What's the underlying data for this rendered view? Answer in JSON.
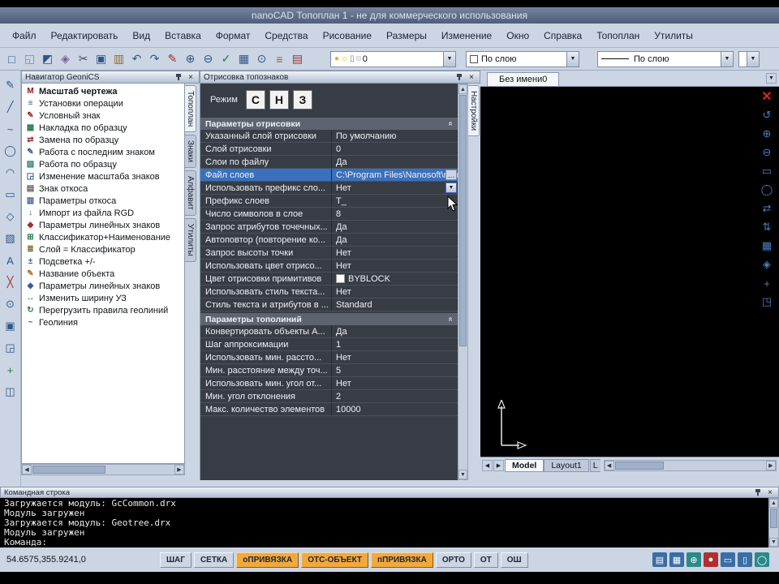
{
  "title_bar": {
    "title": "nanoCAD Топоплан 1 - не для коммерческого использования"
  },
  "menu": {
    "items": [
      "Файл",
      "Редактировать",
      "Вид",
      "Вставка",
      "Формат",
      "Средства",
      "Рисование",
      "Размеры",
      "Изменение",
      "Окно",
      "Справка",
      "Топоплан",
      "Утилиты"
    ]
  },
  "toolbar": {
    "icons": [
      {
        "name": "new-file-icon",
        "glyph": "□",
        "color": "#2f5588"
      },
      {
        "name": "open-file-icon",
        "glyph": "◱",
        "color": "#b08830"
      },
      {
        "name": "save-icon",
        "glyph": "◩",
        "color": "#2f5588"
      },
      {
        "name": "stamp-icon",
        "glyph": "◈",
        "color": "#7a5a9a"
      },
      {
        "name": "cut-icon",
        "glyph": "✂",
        "color": "#444c5a"
      },
      {
        "name": "copy-icon",
        "glyph": "▣",
        "color": "#2f5588"
      },
      {
        "name": "paste-icon",
        "glyph": "▥",
        "color": "#8a6a2a"
      },
      {
        "name": "undo-icon",
        "glyph": "↶",
        "color": "#2f5588"
      },
      {
        "name": "redo-icon",
        "glyph": "↷",
        "color": "#2f5588"
      },
      {
        "name": "format-painter-icon",
        "glyph": "✎",
        "color": "#a03030"
      },
      {
        "name": "zoom-in-icon",
        "glyph": "⊕",
        "color": "#2f5588"
      },
      {
        "name": "zoom-out-icon",
        "glyph": "⊖",
        "color": "#2f5588"
      },
      {
        "name": "check-icon",
        "glyph": "✓",
        "color": "#2a7a2a"
      },
      {
        "name": "table-icon",
        "glyph": "▦",
        "color": "#2f5588"
      },
      {
        "name": "attach-icon",
        "glyph": "⊙",
        "color": "#2f5588"
      },
      {
        "name": "script-icon",
        "glyph": "≡",
        "color": "#8a6a2a"
      },
      {
        "name": "calc-icon",
        "glyph": "▤",
        "color": "#a03030"
      }
    ],
    "layer_combo": {
      "icons": [
        {
          "name": "bulb-icon",
          "glyph": "●",
          "color": "#e0b020"
        },
        {
          "name": "sun-icon",
          "glyph": "☼",
          "color": "#e0b020"
        },
        {
          "name": "lock-icon",
          "glyph": "▯",
          "color": "#707a8a"
        },
        {
          "name": "layer-swatch-icon",
          "glyph": "■",
          "color": "#e8e8e8"
        }
      ],
      "value": "0"
    },
    "color_combo": {
      "value": "По слою"
    },
    "linetype_combo": {
      "value": "По слою"
    }
  },
  "left_toolbar": {
    "icons": [
      {
        "name": "pencil-icon",
        "glyph": "✎",
        "color": "#2f5588"
      },
      {
        "name": "line-icon",
        "glyph": "╱",
        "color": "#2f5588"
      },
      {
        "name": "polyline-icon",
        "glyph": "~",
        "color": "#2f5588"
      },
      {
        "name": "circle-icon",
        "glyph": "◯",
        "color": "#2f5588"
      },
      {
        "name": "arc-icon",
        "glyph": "◠",
        "color": "#2f5588"
      },
      {
        "name": "rectangle-icon",
        "glyph": "▭",
        "color": "#2f5588"
      },
      {
        "name": "polygon-icon",
        "glyph": "◇",
        "color": "#2f5588"
      },
      {
        "name": "hatch-icon",
        "glyph": "▨",
        "color": "#2f5588"
      },
      {
        "name": "text-icon",
        "glyph": "A",
        "color": "#2f5588"
      },
      {
        "name": "erase-icon",
        "glyph": "╳",
        "color": "#a03030"
      },
      {
        "name": "point-icon",
        "glyph": "⊙",
        "color": "#2f5588"
      },
      {
        "name": "block-icon",
        "glyph": "▣",
        "color": "#2f5588"
      },
      {
        "name": "scale-icon",
        "glyph": "◲",
        "color": "#2f5588"
      },
      {
        "name": "plus-icon",
        "glyph": "+",
        "color": "#2a7a4a"
      },
      {
        "name": "dimension-icon",
        "glyph": "◫",
        "color": "#2f5588"
      }
    ]
  },
  "navigator": {
    "title": "Навигатор GeoniCS",
    "items": [
      {
        "label": "Масштаб чертежа",
        "bold": true,
        "icon": "M",
        "icon_color": "#8a1a1a",
        "icon_name": "scale-drawing-icon"
      },
      {
        "label": "Установки операции",
        "icon": "≡",
        "icon_color": "#3a5a9a",
        "icon_name": "operation-settings-icon"
      },
      {
        "label": "Условный знак",
        "icon": "✎",
        "icon_color": "#a03030",
        "icon_name": "symbol-icon"
      },
      {
        "label": "Накладка по образцу",
        "icon": "▦",
        "icon_color": "#2a7a4a",
        "icon_name": "overlay-icon"
      },
      {
        "label": "Замена по образцу",
        "icon": "⇄",
        "icon_color": "#a03030",
        "icon_name": "replace-icon"
      },
      {
        "label": "Работа с последним знаком",
        "icon": "✎",
        "icon_color": "#3a5a9a",
        "icon_name": "last-symbol-icon"
      },
      {
        "label": "Работа по образцу",
        "icon": "▨",
        "icon_color": "#2a7a7a",
        "icon_name": "by-sample-icon"
      },
      {
        "label": "Изменение масштаба знаков",
        "icon": "◲",
        "icon_color": "#3a5a9a",
        "icon_name": "symbol-scale-icon"
      },
      {
        "label": "Знак откоса",
        "icon": "▤",
        "icon_color": "#5a5a5a",
        "icon_name": "slope-symbol-icon"
      },
      {
        "label": "Параметры откоса",
        "icon": "▥",
        "icon_color": "#3a5a9a",
        "icon_name": "slope-params-icon"
      },
      {
        "label": "Импорт из файла RGD",
        "icon": "↓",
        "icon_color": "#3a5a9a",
        "icon_name": "rgd-import-icon"
      },
      {
        "label": "Параметры линейных знаков",
        "icon": "◆",
        "icon_color": "#a03030",
        "icon_name": "linear-symbol-params-icon"
      },
      {
        "label": "Классификатор+Наименование",
        "icon": "⊞",
        "icon_color": "#2a7a4a",
        "icon_name": "classifier-name-icon"
      },
      {
        "label": "Слой = Классификатор",
        "icon": "≣",
        "icon_color": "#7a6a2a",
        "icon_name": "layer-classifier-icon"
      },
      {
        "label": "Подсветка +/-",
        "icon": "±",
        "icon_color": "#3a5a9a",
        "icon_name": "highlight-icon"
      },
      {
        "label": "Название объекта",
        "icon": "✎",
        "icon_color": "#b07020",
        "icon_name": "object-name-icon"
      },
      {
        "label": "Параметры линейных знаков",
        "icon": "◆",
        "icon_color": "#3a5a9a",
        "icon_name": "linear-symbol-params2-icon"
      },
      {
        "label": "Изменить ширину УЗ",
        "icon": "↔",
        "icon_color": "#2a7a4a",
        "icon_name": "width-change-icon"
      },
      {
        "label": "Перегрузить правила геолиний",
        "icon": "↻",
        "icon_color": "#2a7a4a",
        "icon_name": "reload-rules-icon"
      },
      {
        "label": "Геолиния",
        "icon": "~",
        "icon_color": "#3a5a9a",
        "icon_name": "geoline-icon"
      }
    ],
    "tabs": [
      "Топоплан",
      "Знаки",
      "Алфавит",
      "Утилиты"
    ]
  },
  "properties_panel": {
    "title": "Отрисовка топознаков",
    "mode_label": "Режим",
    "mode_buttons": [
      "С",
      "Н",
      "З"
    ],
    "side_tab": "Настройки",
    "sections": [
      {
        "header": "Параметры отрисовки",
        "rows": [
          {
            "label": "Указанный слой отрисовки",
            "value": "По умолчанию"
          },
          {
            "label": "Слой отрисовки",
            "value": "0"
          },
          {
            "label": "Слои по файлу",
            "value": "Да"
          },
          {
            "label": "Файл слоев",
            "value": "C:\\Program Files\\Nanosoft\\nano",
            "selected": true,
            "browse": true
          },
          {
            "label": "Использовать префикс сло...",
            "value": "Нет",
            "dropdown": true
          },
          {
            "label": "Префикс слоев",
            "value": "T_"
          },
          {
            "label": "Число символов в слое",
            "value": "8"
          },
          {
            "label": "Запрос атрибутов точечных...",
            "value": "Да"
          },
          {
            "label": "Автоповтор (повторение ко...",
            "value": "Да"
          },
          {
            "label": "Запрос высоты точки",
            "value": "Нет"
          },
          {
            "label": "Использовать цвет отрисо...",
            "value": "Нет"
          },
          {
            "label": "Цвет отрисовки примитивов",
            "value": "BYBLOCK",
            "swatch": true
          },
          {
            "label": "Использовать стиль текста...",
            "value": "Нет"
          },
          {
            "label": "Стиль текста и атрибутов в ...",
            "value": "Standard"
          }
        ]
      },
      {
        "header": "Параметры тополиний",
        "rows": [
          {
            "label": "Конвертировать объекты А...",
            "value": "Да"
          },
          {
            "label": "Шаг аппроксимации",
            "value": "1"
          },
          {
            "label": "Использовать мин. рассто...",
            "value": "Нет"
          },
          {
            "label": "Мин. расстояние между точ...",
            "value": "5"
          },
          {
            "label": "Использовать мин. угол от...",
            "value": "Нет"
          },
          {
            "label": "Мин. угол отклонения",
            "value": "2"
          },
          {
            "label": "Макс. количество элементов",
            "value": "10000"
          }
        ]
      }
    ]
  },
  "drawing": {
    "doc_tab": "Без имени0",
    "layout_tabs": [
      "Model",
      "Layout1"
    ],
    "partial_tab": "L",
    "side_icons": [
      {
        "name": "close-icon",
        "glyph": "✕",
        "red": true
      },
      {
        "name": "orbit-icon",
        "glyph": "↺"
      },
      {
        "name": "zoom-in-icon",
        "glyph": "⊕"
      },
      {
        "name": "zoom-out-icon",
        "glyph": "⊖"
      },
      {
        "name": "zoom-window-icon",
        "glyph": "▭"
      },
      {
        "name": "zoom-extents-icon",
        "glyph": "◯"
      },
      {
        "name": "pan-horizontal-icon",
        "glyph": "⇄"
      },
      {
        "name": "pan-vertical-icon",
        "glyph": "⇅"
      },
      {
        "name": "grid-icon",
        "glyph": "▦"
      },
      {
        "name": "view-icon",
        "glyph": "◈"
      },
      {
        "name": "pan-icon",
        "glyph": "+"
      },
      {
        "name": "viewport-icon",
        "glyph": "◳"
      }
    ]
  },
  "command_line": {
    "title": "Командная строка",
    "lines": [
      "Загружается модуль: GcCommon.drx",
      "Модуль загружен",
      "Загружается модуль: Geotree.drx",
      "Модуль загружен",
      "Команда:"
    ]
  },
  "status_bar": {
    "coords": "54.6575,355.9241,0",
    "buttons": [
      {
        "label": "ШАГ",
        "active": false
      },
      {
        "label": "СЕТКА",
        "active": false
      },
      {
        "label": "оПРИВЯЗКА",
        "active": true
      },
      {
        "label": "ОТС-ОБЪЕКТ",
        "active": true
      },
      {
        "label": "пПРИВЯЗКА",
        "active": true
      },
      {
        "label": "ОРТО",
        "active": false
      },
      {
        "label": "ОТ",
        "active": false
      },
      {
        "label": "ОШ",
        "active": false
      }
    ],
    "icons": [
      {
        "name": "notes-icon",
        "glyph": "▤",
        "bg": "#3a6ea5"
      },
      {
        "name": "layers-icon",
        "glyph": "▦",
        "bg": "#3a6ea5"
      },
      {
        "name": "zoom-icon",
        "glyph": "⊕",
        "bg": "#2a8a8a"
      },
      {
        "name": "record-icon",
        "glyph": "●",
        "bg": "#b03030"
      },
      {
        "name": "monitor-icon",
        "glyph": "▭",
        "bg": "#3a6ea5"
      },
      {
        "name": "lock-icon",
        "glyph": "▯",
        "bg": "#3a6ea5"
      },
      {
        "name": "globe-icon",
        "glyph": "◯",
        "bg": "#2a8a8a"
      }
    ]
  }
}
